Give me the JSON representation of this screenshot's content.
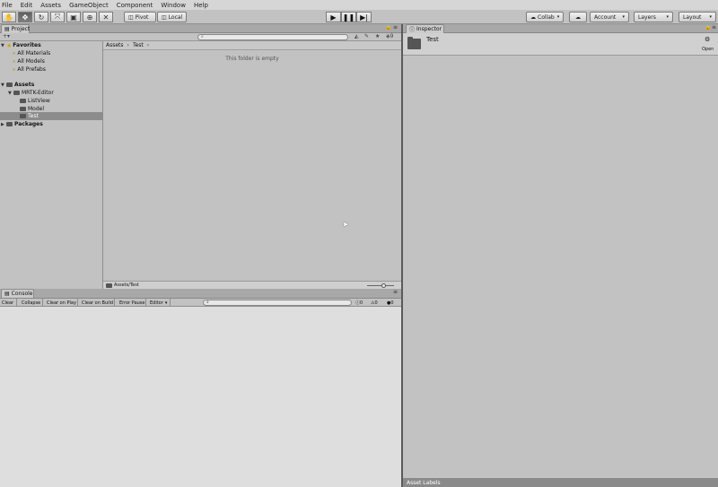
{
  "menu": [
    "File",
    "Edit",
    "Assets",
    "GameObject",
    "Component",
    "Window",
    "Help"
  ],
  "toolbar": {
    "tools": [
      "hand-icon",
      "move-icon",
      "rotate-icon",
      "scale-icon",
      "rect-icon",
      "transform-icon",
      "custom-tool-icon"
    ],
    "pivot_label": "Pivot",
    "local_label": "Local",
    "collab_label": "Collab",
    "account_label": "Account",
    "layers_label": "Layers",
    "layout_label": "Layout"
  },
  "project": {
    "tab_label": "Project",
    "search_placeholder": "",
    "favorites_label": "Favorites",
    "favorites": [
      "All Materials",
      "All Models",
      "All Prefabs"
    ],
    "assets_label": "Assets",
    "assets_children": [
      "MRTK-Editor"
    ],
    "mrtk_children": [
      "ListView",
      "Model",
      "Test"
    ],
    "packages_label": "Packages",
    "breadcrumb": [
      "Assets",
      "Test"
    ],
    "empty_message": "This folder is empty",
    "status_path": "Assets/Test"
  },
  "console": {
    "tab_label": "Console",
    "buttons": [
      "Clear",
      "Collapse",
      "Clear on Play",
      "Clear on Build",
      "Error Pause",
      "Editor"
    ],
    "counts": {
      "log": "0",
      "warn": "0",
      "error": "0"
    }
  },
  "inspector": {
    "tab_label": "Inspector",
    "title": "Test",
    "open_label": "Open",
    "footer": "Asset Labels"
  }
}
